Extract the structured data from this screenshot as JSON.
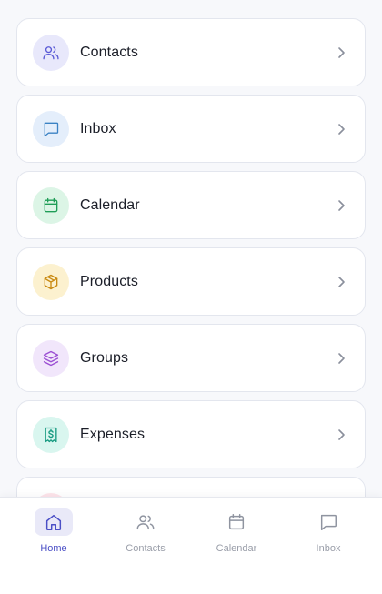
{
  "menu": {
    "items": [
      {
        "label": "Contacts",
        "icon": "users-icon",
        "color": "#5b5bd6"
      },
      {
        "label": "Inbox",
        "icon": "message-icon",
        "color": "#3b82c4"
      },
      {
        "label": "Calendar",
        "icon": "calendar-icon",
        "color": "#1f9d57"
      },
      {
        "label": "Products",
        "icon": "package-icon",
        "color": "#c98a12"
      },
      {
        "label": "Groups",
        "icon": "layers-icon",
        "color": "#9b4fd3"
      },
      {
        "label": "Expenses",
        "icon": "receipt-icon",
        "color": "#169a80"
      }
    ]
  },
  "bottom_nav": {
    "items": [
      {
        "label": "Home",
        "icon": "home-icon",
        "active": true
      },
      {
        "label": "Contacts",
        "icon": "users-icon",
        "active": false
      },
      {
        "label": "Calendar",
        "icon": "calendar-icon",
        "active": false
      },
      {
        "label": "Inbox",
        "icon": "message-icon",
        "active": false
      }
    ],
    "active_color": "#4b4fc6"
  }
}
